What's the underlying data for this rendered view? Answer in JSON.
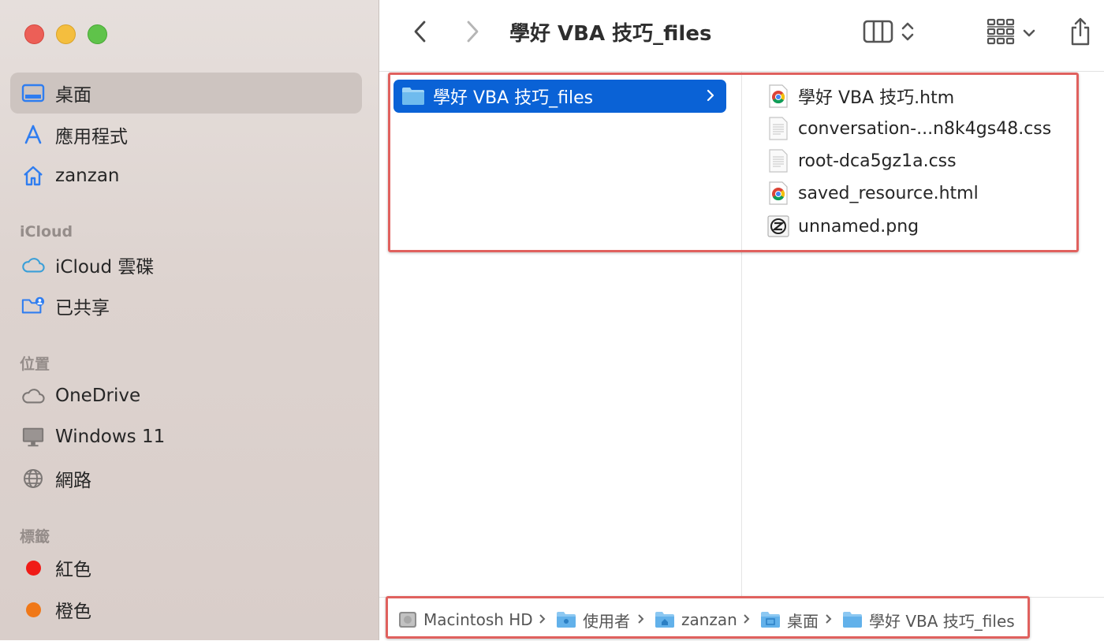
{
  "window": {
    "title": "學好 VBA 技巧_files"
  },
  "sidebar": {
    "favorites": [
      {
        "label": "桌面",
        "icon": "desktop-icon",
        "selected": true
      },
      {
        "label": "應用程式",
        "icon": "applications-icon"
      },
      {
        "label": "zanzan",
        "icon": "home-icon"
      }
    ],
    "icloud_header": "iCloud",
    "icloud": [
      {
        "label": "iCloud 雲碟",
        "icon": "cloud-icon"
      },
      {
        "label": "已共享",
        "icon": "shared-folder-icon"
      }
    ],
    "locations_header": "位置",
    "locations": [
      {
        "label": "OneDrive",
        "icon": "cloud-outline-icon"
      },
      {
        "label": "Windows 11",
        "icon": "display-icon"
      },
      {
        "label": "網路",
        "icon": "network-globe-icon"
      }
    ],
    "tags_header": "標籤",
    "tags": [
      {
        "label": "紅色",
        "color": "#f01b17"
      },
      {
        "label": "橙色",
        "color": "#f07818"
      }
    ]
  },
  "toolbar": {
    "back_icon": "chevron-left-icon",
    "forward_icon": "chevron-right-icon",
    "view_icon": "column-view-icon",
    "group_icon": "grid-group-icon",
    "share_icon": "share-icon"
  },
  "columns": {
    "first": {
      "selected_folder": "學好 VBA 技巧_files"
    },
    "second": {
      "files": [
        {
          "name": "學好 VBA 技巧.htm",
          "icon": "chrome-doc-icon"
        },
        {
          "name": "conversation-...n8k4gs48.css",
          "icon": "text-doc-icon"
        },
        {
          "name": "root-dca5gz1a.css",
          "icon": "text-doc-icon"
        },
        {
          "name": "saved_resource.html",
          "icon": "chrome-doc-icon"
        },
        {
          "name": "unnamed.png",
          "icon": "image-doc-icon"
        }
      ]
    }
  },
  "pathbar": {
    "crumbs": [
      {
        "label": "Macintosh HD",
        "icon": "hard-drive-icon"
      },
      {
        "label": "使用者",
        "icon": "folder-icon"
      },
      {
        "label": "zanzan",
        "icon": "home-folder-icon"
      },
      {
        "label": "桌面",
        "icon": "desktop-folder-icon"
      },
      {
        "label": "學好 VBA 技巧_files",
        "icon": "folder-icon"
      }
    ]
  },
  "colors": {
    "selection": "#0a62d6",
    "highlight_box": "#e0615e",
    "sidebar_icon": "#2f7df0"
  }
}
